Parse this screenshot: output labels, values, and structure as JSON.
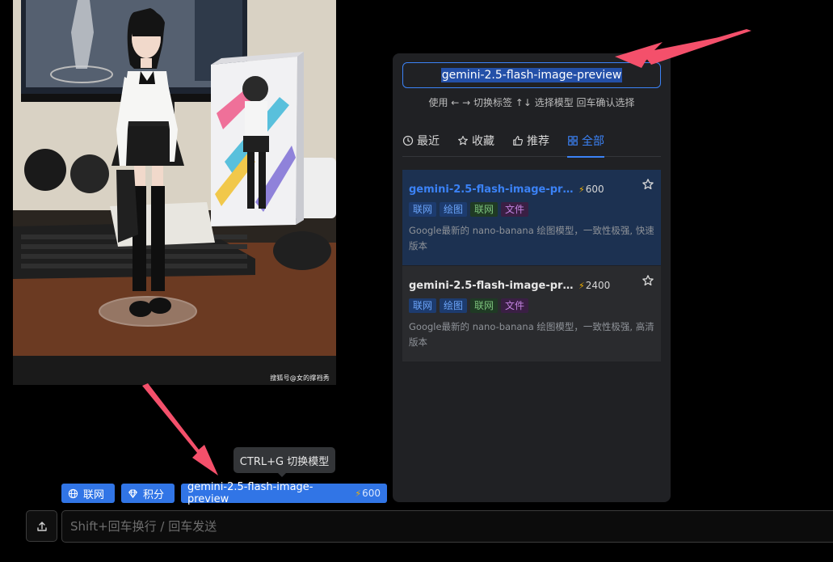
{
  "photo": {
    "watermark": "搜狐号@女的撑裆秀"
  },
  "picker": {
    "search_value": "gemini-2.5-flash-image-preview",
    "hint": "使用 ← → 切换标签  ↑↓ 选择模型  回车确认选择",
    "tabs": [
      {
        "label": "最近",
        "icon": "clock-icon"
      },
      {
        "label": "收藏",
        "icon": "star-icon"
      },
      {
        "label": "推荐",
        "icon": "thumbs-up-icon"
      },
      {
        "label": "全部",
        "icon": "grid-icon"
      }
    ],
    "active_tab": "全部",
    "models": [
      {
        "name": "gemini-2.5-flash-image-preview",
        "cost": "600",
        "tags": [
          "联网",
          "绘图",
          "联网",
          "文件"
        ],
        "description": "Google最新的 nano-banana 绘图模型，一致性极强, 快速版本",
        "selected": true
      },
      {
        "name": "gemini-2.5-flash-image-preview",
        "cost": "2400",
        "tags": [
          "联网",
          "绘图",
          "联网",
          "文件"
        ],
        "description": "Google最新的 nano-banana 绘图模型，一致性极强, 高清版本",
        "selected": false
      }
    ]
  },
  "tooltip": {
    "text": "CTRL+G 切换模型"
  },
  "chips": {
    "web_label": "联网",
    "points_label": "积分",
    "model_label": "gemini-2.5-flash-image-preview",
    "model_cost": "600"
  },
  "composer": {
    "placeholder": "Shift+回车换行 / 回车发送"
  },
  "colors": {
    "accent": "#3b82f6",
    "chip_bg": "#3175e6",
    "panel_bg": "#202124",
    "arrow": "#f4506b",
    "bolt": "#f5b301"
  }
}
